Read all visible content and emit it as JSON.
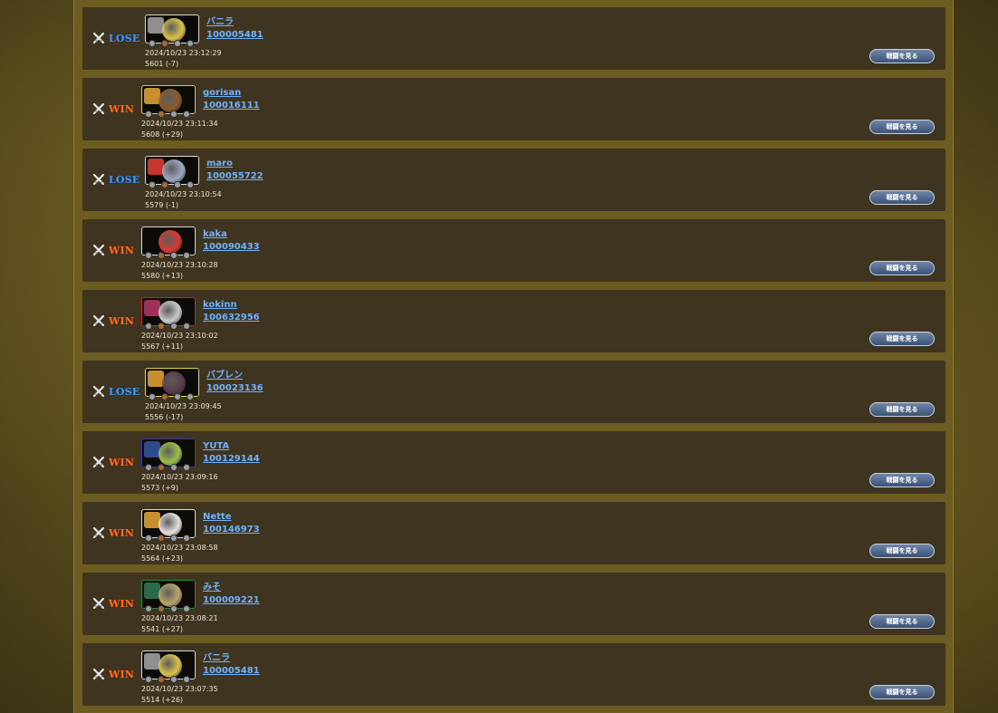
{
  "colors": {
    "win": "#ff6a1a",
    "lose": "#3f9bff",
    "link": "#6fb2ff",
    "row_bg": "#3e3420",
    "button": "#4f6690"
  },
  "button_label": "戦闘を見る",
  "matches": [
    {
      "result": "LOSE",
      "name": "バニラ",
      "id": "100005481",
      "datetime": "2024/10/23 23:12:29",
      "rating": "5601 (-7)",
      "frame_color": "#d8d8d8",
      "char1": "#8f8f8f",
      "char2": "#d9c24b",
      "rank_emblem": "armored-knight-icon"
    },
    {
      "result": "WIN",
      "name": "gorisan",
      "id": "100016111",
      "datetime": "2024/10/23 23:11:34",
      "rating": "5608 (+29)",
      "frame_color": "#d8c94a",
      "char1": "#c98f2d",
      "char2": "#8a5a2a",
      "rank_emblem": "lion-emblem-icon"
    },
    {
      "result": "LOSE",
      "name": "maro",
      "id": "100055722",
      "datetime": "2024/10/23 23:10:54",
      "rating": "5579 (-1)",
      "frame_color": "#d8d8d8",
      "char1": "#c4362b",
      "char2": "#9aa7c4",
      "rank_emblem": "red-warrior-icon"
    },
    {
      "result": "WIN",
      "name": "kaka",
      "id": "100090433",
      "datetime": "2024/10/23 23:10:28",
      "rating": "5580 (+13)",
      "frame_color": "#d8d8d8",
      "char1": "#0d0b08",
      "char2": "#d83a35",
      "rank_emblem": "red-orb-icon"
    },
    {
      "result": "WIN",
      "name": "kokinn",
      "id": "100632956",
      "datetime": "2024/10/23 23:10:02",
      "rating": "5567 (+11)",
      "frame_color": "#c0282a",
      "char1": "#a0305a",
      "char2": "#c9c9c9",
      "rank_emblem": "crimson-mage-icon"
    },
    {
      "result": "LOSE",
      "name": "バブレン",
      "id": "100023136",
      "datetime": "2024/10/23 23:09:45",
      "rating": "5556 (-17)",
      "frame_color": "#e2d84a",
      "char1": "#c98f2d",
      "char2": "#5a3a4a",
      "rank_emblem": "lion-emblem-icon"
    },
    {
      "result": "WIN",
      "name": "YUTA",
      "id": "100129144",
      "datetime": "2024/10/23 23:09:16",
      "rating": "5573 (+9)",
      "frame_color": "#3a3aa8",
      "char1": "#2e4a8f",
      "char2": "#9cc04a",
      "rank_emblem": "blue-dragon-icon"
    },
    {
      "result": "WIN",
      "name": "Nette",
      "id": "100146973",
      "datetime": "2024/10/23 23:08:58",
      "rating": "5564 (+23)",
      "frame_color": "#d8d8d8",
      "char1": "#c98f2d",
      "char2": "#e8e0dc",
      "rank_emblem": "lion-emblem-icon"
    },
    {
      "result": "WIN",
      "name": "みそ",
      "id": "100009221",
      "datetime": "2024/10/23 23:08:21",
      "rating": "5541 (+27)",
      "frame_color": "#2a8a3a",
      "char1": "#2a6a4a",
      "char2": "#b9a56a",
      "rank_emblem": "green-spear-icon"
    },
    {
      "result": "WIN",
      "name": "バニラ",
      "id": "100005481",
      "datetime": "2024/10/23 23:07:35",
      "rating": "5514 (+26)",
      "frame_color": "#d8d8d8",
      "char1": "#8f8f8f",
      "char2": "#d9c24b",
      "rank_emblem": "armored-knight-icon"
    }
  ]
}
